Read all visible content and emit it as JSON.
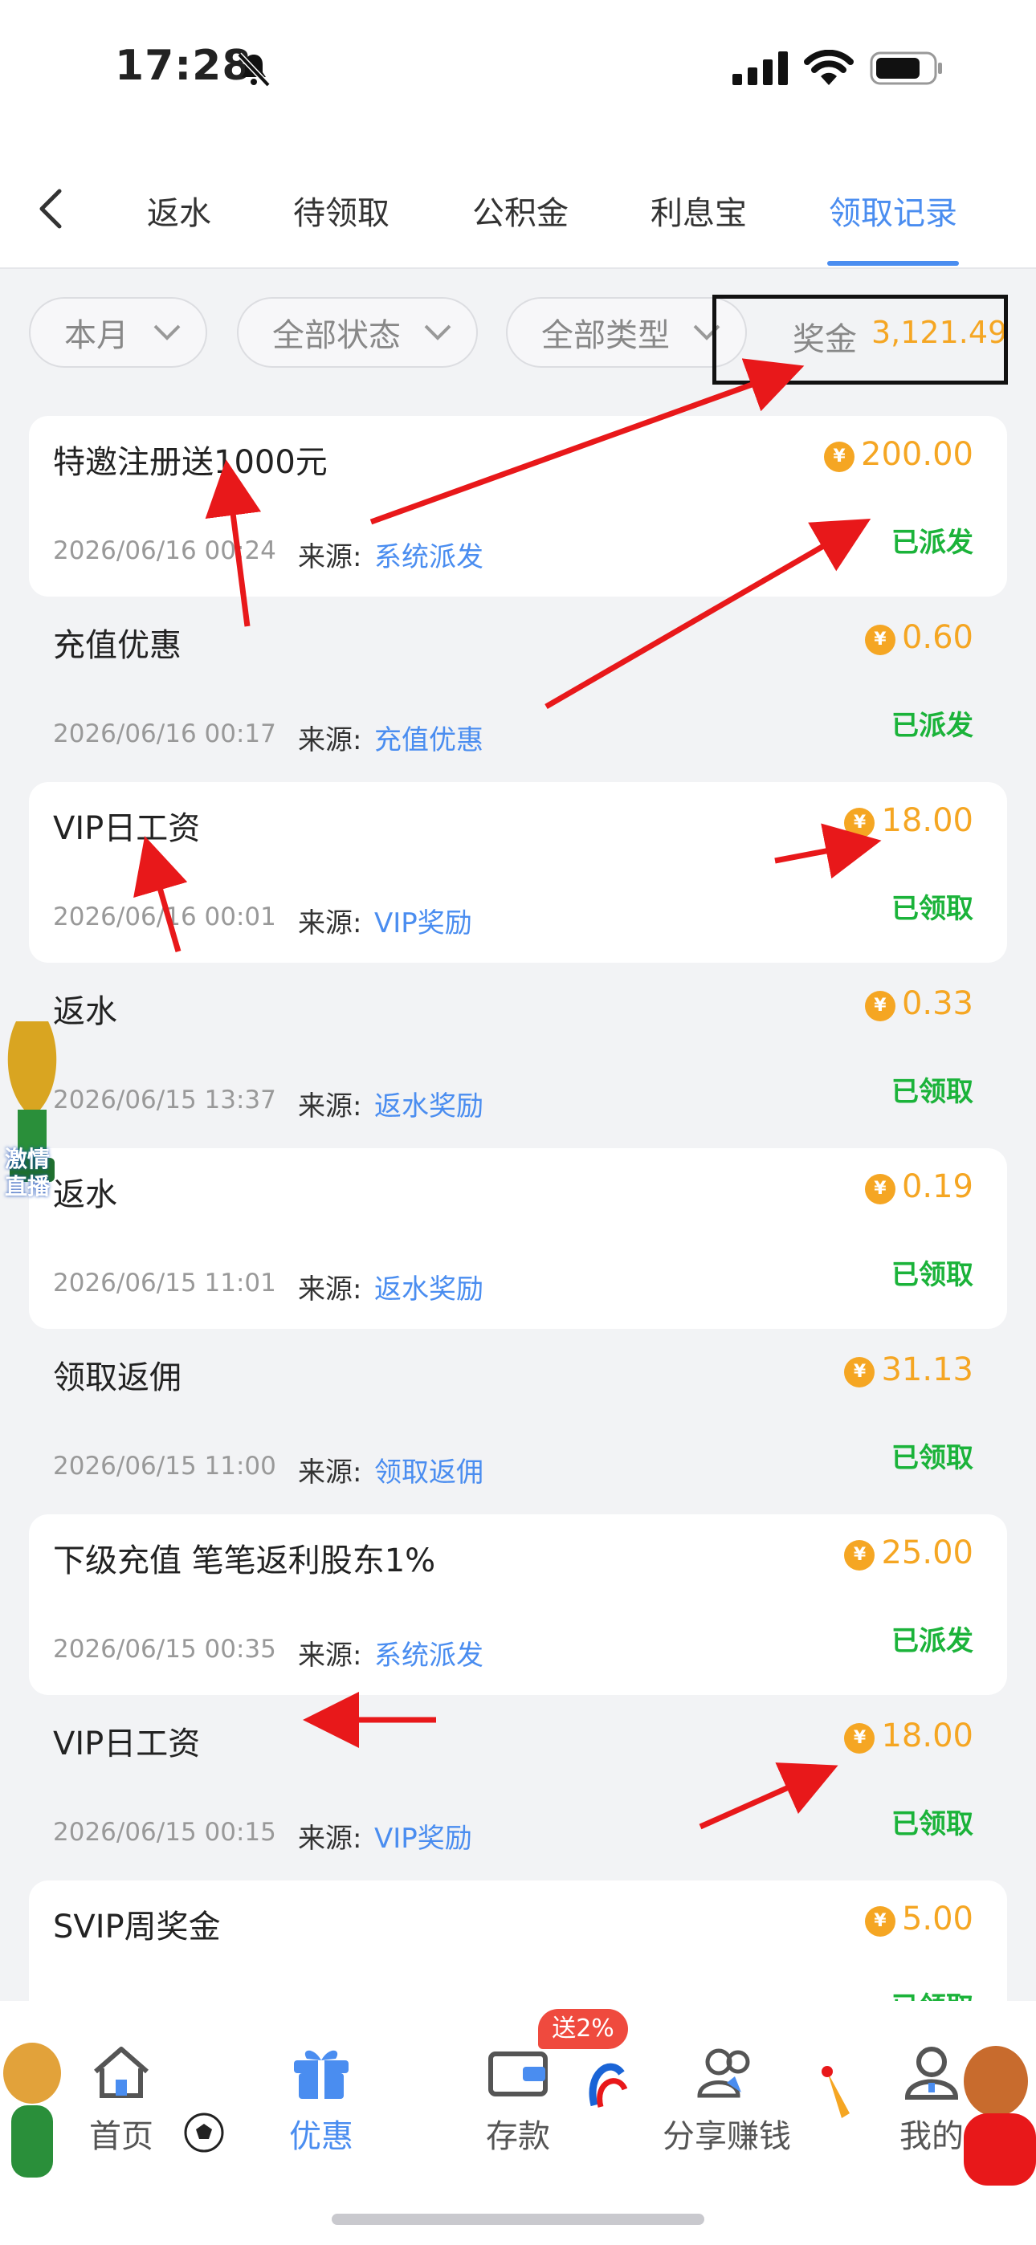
{
  "status_bar": {
    "time": "17:28"
  },
  "tabs": [
    {
      "label": "返水"
    },
    {
      "label": "待领取"
    },
    {
      "label": "公积金"
    },
    {
      "label": "利息宝"
    },
    {
      "label": "领取记录"
    }
  ],
  "filters": {
    "month": "本月",
    "status": "全部状态",
    "type": "全部类型",
    "bonus_label": "奖金",
    "bonus_value": "3,121.49"
  },
  "records": [
    {
      "title": "特邀注册送1000元",
      "date": "2026/06/16 00:24",
      "source_label": "来源:",
      "source": "系统派发",
      "amount": "200.00",
      "status": "已派发"
    },
    {
      "title": "充值优惠",
      "date": "2026/06/16 00:17",
      "source_label": "来源:",
      "source": "充值优惠",
      "amount": "0.60",
      "status": "已派发"
    },
    {
      "title": "VIP日工资",
      "date": "2026/06/16 00:01",
      "source_label": "来源:",
      "source": "VIP奖励",
      "amount": "18.00",
      "status": "已领取"
    },
    {
      "title": "返水",
      "date": "2026/06/15 13:37",
      "source_label": "来源:",
      "source": "返水奖励",
      "amount": "0.33",
      "status": "已领取"
    },
    {
      "title": "返水",
      "date": "2026/06/15 11:01",
      "source_label": "来源:",
      "source": "返水奖励",
      "amount": "0.19",
      "status": "已领取"
    },
    {
      "title": "领取返佣",
      "date": "2026/06/15 11:00",
      "source_label": "来源:",
      "source": "领取返佣",
      "amount": "31.13",
      "status": "已领取"
    },
    {
      "title": "下级充值 笔笔返利股东1%",
      "date": "2026/06/15 00:35",
      "source_label": "来源:",
      "source": "系统派发",
      "amount": "25.00",
      "status": "已派发"
    },
    {
      "title": "VIP日工资",
      "date": "2026/06/15 00:15",
      "source_label": "来源:",
      "source": "VIP奖励",
      "amount": "18.00",
      "status": "已领取"
    },
    {
      "title": "SVIP周奖金",
      "date": "",
      "source_label": "",
      "source": "",
      "amount": "5.00",
      "status": "已领取"
    }
  ],
  "coin_symbol": "¥",
  "floating_badge": {
    "line1": "激情",
    "line2": "直播"
  },
  "bottom_nav": {
    "home": "首页",
    "promo": "优惠",
    "deposit": "存款",
    "deposit_badge": "送2%",
    "share": "分享赚钱",
    "mine": "我的"
  },
  "colors": {
    "accent": "#4a8df0",
    "amount": "#f5a623",
    "status_green": "#1bb33a",
    "annotation_red": "#e8181a"
  }
}
